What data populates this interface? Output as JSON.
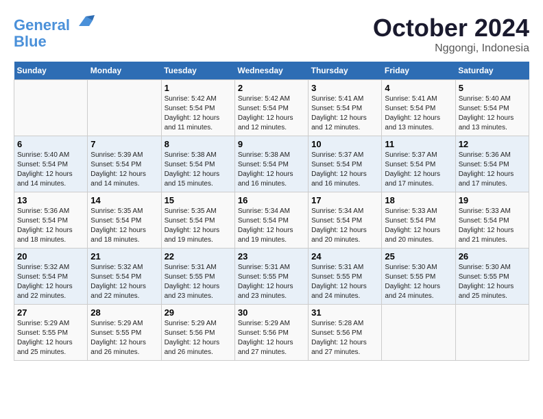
{
  "header": {
    "logo_line1": "General",
    "logo_line2": "Blue",
    "month": "October 2024",
    "location": "Nggongi, Indonesia"
  },
  "weekdays": [
    "Sunday",
    "Monday",
    "Tuesday",
    "Wednesday",
    "Thursday",
    "Friday",
    "Saturday"
  ],
  "weeks": [
    [
      {
        "day": "",
        "info": ""
      },
      {
        "day": "",
        "info": ""
      },
      {
        "day": "1",
        "info": "Sunrise: 5:42 AM\nSunset: 5:54 PM\nDaylight: 12 hours\nand 11 minutes."
      },
      {
        "day": "2",
        "info": "Sunrise: 5:42 AM\nSunset: 5:54 PM\nDaylight: 12 hours\nand 12 minutes."
      },
      {
        "day": "3",
        "info": "Sunrise: 5:41 AM\nSunset: 5:54 PM\nDaylight: 12 hours\nand 12 minutes."
      },
      {
        "day": "4",
        "info": "Sunrise: 5:41 AM\nSunset: 5:54 PM\nDaylight: 12 hours\nand 13 minutes."
      },
      {
        "day": "5",
        "info": "Sunrise: 5:40 AM\nSunset: 5:54 PM\nDaylight: 12 hours\nand 13 minutes."
      }
    ],
    [
      {
        "day": "6",
        "info": "Sunrise: 5:40 AM\nSunset: 5:54 PM\nDaylight: 12 hours\nand 14 minutes."
      },
      {
        "day": "7",
        "info": "Sunrise: 5:39 AM\nSunset: 5:54 PM\nDaylight: 12 hours\nand 14 minutes."
      },
      {
        "day": "8",
        "info": "Sunrise: 5:38 AM\nSunset: 5:54 PM\nDaylight: 12 hours\nand 15 minutes."
      },
      {
        "day": "9",
        "info": "Sunrise: 5:38 AM\nSunset: 5:54 PM\nDaylight: 12 hours\nand 16 minutes."
      },
      {
        "day": "10",
        "info": "Sunrise: 5:37 AM\nSunset: 5:54 PM\nDaylight: 12 hours\nand 16 minutes."
      },
      {
        "day": "11",
        "info": "Sunrise: 5:37 AM\nSunset: 5:54 PM\nDaylight: 12 hours\nand 17 minutes."
      },
      {
        "day": "12",
        "info": "Sunrise: 5:36 AM\nSunset: 5:54 PM\nDaylight: 12 hours\nand 17 minutes."
      }
    ],
    [
      {
        "day": "13",
        "info": "Sunrise: 5:36 AM\nSunset: 5:54 PM\nDaylight: 12 hours\nand 18 minutes."
      },
      {
        "day": "14",
        "info": "Sunrise: 5:35 AM\nSunset: 5:54 PM\nDaylight: 12 hours\nand 18 minutes."
      },
      {
        "day": "15",
        "info": "Sunrise: 5:35 AM\nSunset: 5:54 PM\nDaylight: 12 hours\nand 19 minutes."
      },
      {
        "day": "16",
        "info": "Sunrise: 5:34 AM\nSunset: 5:54 PM\nDaylight: 12 hours\nand 19 minutes."
      },
      {
        "day": "17",
        "info": "Sunrise: 5:34 AM\nSunset: 5:54 PM\nDaylight: 12 hours\nand 20 minutes."
      },
      {
        "day": "18",
        "info": "Sunrise: 5:33 AM\nSunset: 5:54 PM\nDaylight: 12 hours\nand 20 minutes."
      },
      {
        "day": "19",
        "info": "Sunrise: 5:33 AM\nSunset: 5:54 PM\nDaylight: 12 hours\nand 21 minutes."
      }
    ],
    [
      {
        "day": "20",
        "info": "Sunrise: 5:32 AM\nSunset: 5:54 PM\nDaylight: 12 hours\nand 22 minutes."
      },
      {
        "day": "21",
        "info": "Sunrise: 5:32 AM\nSunset: 5:54 PM\nDaylight: 12 hours\nand 22 minutes."
      },
      {
        "day": "22",
        "info": "Sunrise: 5:31 AM\nSunset: 5:55 PM\nDaylight: 12 hours\nand 23 minutes."
      },
      {
        "day": "23",
        "info": "Sunrise: 5:31 AM\nSunset: 5:55 PM\nDaylight: 12 hours\nand 23 minutes."
      },
      {
        "day": "24",
        "info": "Sunrise: 5:31 AM\nSunset: 5:55 PM\nDaylight: 12 hours\nand 24 minutes."
      },
      {
        "day": "25",
        "info": "Sunrise: 5:30 AM\nSunset: 5:55 PM\nDaylight: 12 hours\nand 24 minutes."
      },
      {
        "day": "26",
        "info": "Sunrise: 5:30 AM\nSunset: 5:55 PM\nDaylight: 12 hours\nand 25 minutes."
      }
    ],
    [
      {
        "day": "27",
        "info": "Sunrise: 5:29 AM\nSunset: 5:55 PM\nDaylight: 12 hours\nand 25 minutes."
      },
      {
        "day": "28",
        "info": "Sunrise: 5:29 AM\nSunset: 5:55 PM\nDaylight: 12 hours\nand 26 minutes."
      },
      {
        "day": "29",
        "info": "Sunrise: 5:29 AM\nSunset: 5:56 PM\nDaylight: 12 hours\nand 26 minutes."
      },
      {
        "day": "30",
        "info": "Sunrise: 5:29 AM\nSunset: 5:56 PM\nDaylight: 12 hours\nand 27 minutes."
      },
      {
        "day": "31",
        "info": "Sunrise: 5:28 AM\nSunset: 5:56 PM\nDaylight: 12 hours\nand 27 minutes."
      },
      {
        "day": "",
        "info": ""
      },
      {
        "day": "",
        "info": ""
      }
    ]
  ]
}
